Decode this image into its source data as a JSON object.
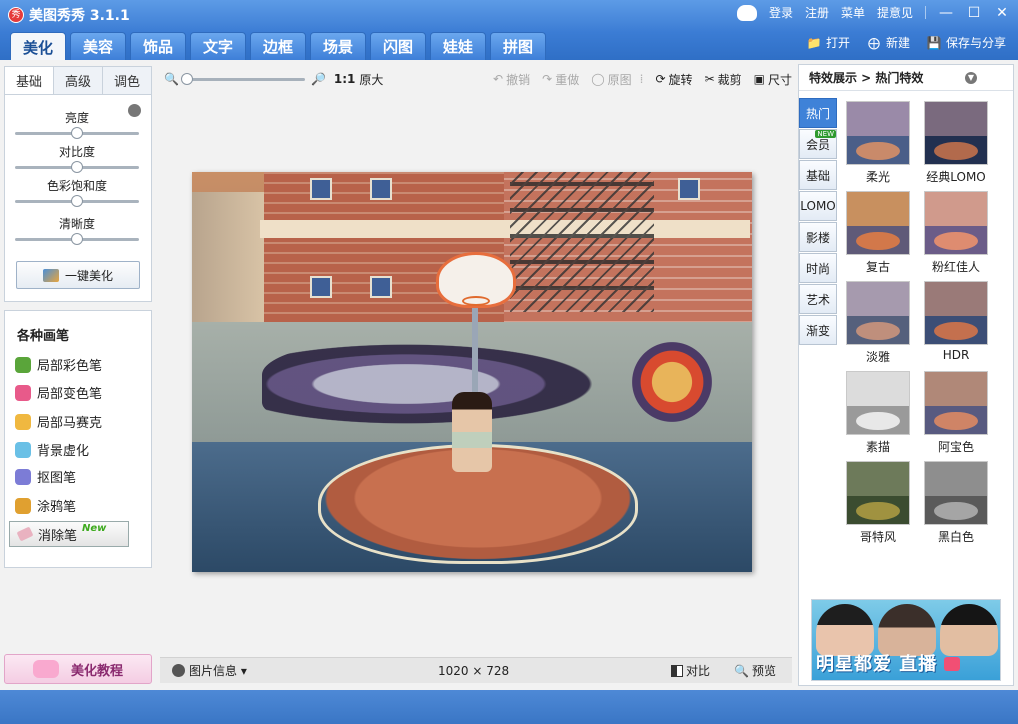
{
  "app": {
    "title": "美图秀秀 3.1.1",
    "logo_text": "秀"
  },
  "title_bar": {
    "login": "登录",
    "register": "注册",
    "menu": "菜单",
    "tips": "提意见"
  },
  "main_tabs": [
    "美化",
    "美容",
    "饰品",
    "文字",
    "边框",
    "场景",
    "闪图",
    "娃娃",
    "拼图"
  ],
  "actions": {
    "open": "打开",
    "new": "新建",
    "save": "保存与分享"
  },
  "left": {
    "sub_tabs": [
      "基础",
      "高级",
      "调色"
    ],
    "sliders": [
      {
        "label": "亮度",
        "value": 0.5
      },
      {
        "label": "对比度",
        "value": 0.5
      },
      {
        "label": "色彩饱和度",
        "value": 0.5
      },
      {
        "label": "清晰度",
        "value": 0.5
      }
    ],
    "one_key": "一键美化",
    "brushes_title": "各种画笔",
    "brushes": [
      {
        "label": "局部彩色笔",
        "color": "#5aa53a"
      },
      {
        "label": "局部变色笔",
        "color": "#e85a8a"
      },
      {
        "label": "局部马赛克",
        "color": "#f0b840"
      },
      {
        "label": "背景虚化",
        "color": "#6ac0e6"
      },
      {
        "label": "抠图笔",
        "color": "#7c7cd6"
      },
      {
        "label": "涂鸦笔",
        "color": "#e0a030"
      }
    ],
    "eraser": "消除笔",
    "eraser_badge": "New",
    "tutorial": "美化教程"
  },
  "toolbar": {
    "ratio": "1:1",
    "original_size": "原大",
    "undo": "撤销",
    "redo": "重做",
    "original": "原图",
    "rotate": "旋转",
    "crop": "裁剪",
    "resize": "尺寸"
  },
  "info": {
    "image_info": "图片信息",
    "width": "1020",
    "times": "×",
    "height": "728",
    "compare": "对比",
    "preview": "预览"
  },
  "right": {
    "header": "特效展示 > 热门特效",
    "categories": [
      {
        "label": "热门",
        "active": true
      },
      {
        "label": "会员",
        "badge": "NEW"
      },
      {
        "label": "基础"
      },
      {
        "label": "LOMO"
      },
      {
        "label": "影楼"
      },
      {
        "label": "时尚"
      },
      {
        "label": "艺术"
      },
      {
        "label": "渐变"
      }
    ],
    "effects": [
      {
        "label": "柔光",
        "wall": "#9a8aa8",
        "court": "#4a5e88",
        "key": "#c98a6a"
      },
      {
        "label": "经典LOMO",
        "wall": "#7a6a7e",
        "court": "#223050",
        "key": "#b26a4c"
      },
      {
        "label": "复古",
        "wall": "#c8905f",
        "court": "#5f5a78",
        "key": "#d2784a"
      },
      {
        "label": "粉红佳人",
        "wall": "#d09a8c",
        "court": "#6b5c88",
        "key": "#de8c70"
      },
      {
        "label": "淡雅",
        "wall": "#a69aae",
        "court": "#55607c",
        "key": "#bf8f7c"
      },
      {
        "label": "HDR",
        "wall": "#9a7a78",
        "court": "#3c4e76",
        "key": "#c4704e"
      },
      {
        "label": "素描",
        "wall": "#dcdcdc",
        "court": "#9a9a9a",
        "key": "#e8e8e8"
      },
      {
        "label": "阿宝色",
        "wall": "#b08878",
        "court": "#585a80",
        "key": "#cf8466"
      },
      {
        "label": "哥特风",
        "wall": "#6d7a5a",
        "court": "#3b4c30",
        "key": "#a09240"
      },
      {
        "label": "黑白色",
        "wall": "#8e8e8e",
        "court": "#5a5a5a",
        "key": "#a5a5a5"
      }
    ],
    "ad_text": "明星都爱  直播"
  }
}
